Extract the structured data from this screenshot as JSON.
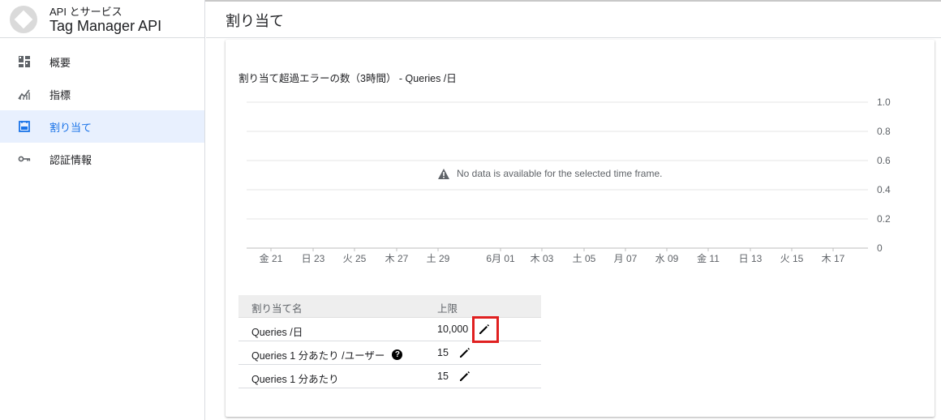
{
  "app": {
    "breadcrumb": "API とサービス",
    "title": "Tag Manager API"
  },
  "sidebar": {
    "items": [
      {
        "label": "概要",
        "icon": "dashboard-icon",
        "active": false
      },
      {
        "label": "指標",
        "icon": "metrics-icon",
        "active": false
      },
      {
        "label": "割り当て",
        "icon": "quota-icon",
        "active": true
      },
      {
        "label": "認証情報",
        "icon": "key-icon",
        "active": false
      }
    ]
  },
  "page": {
    "title": "割り当て"
  },
  "chart": {
    "title": "割り当て超過エラーの数（3時間） - Queries /日",
    "no_data": "No data is available for the selected time frame."
  },
  "chart_data": {
    "type": "line",
    "title": "割り当て超過エラーの数（3時間） - Queries /日",
    "x": [
      "金 21",
      "日 23",
      "火 25",
      "木 27",
      "土 29",
      "6月 01",
      "木 03",
      "土 05",
      "月 07",
      "水 09",
      "金 11",
      "日 13",
      "火 15",
      "木 17"
    ],
    "y_ticks": [
      "1.0",
      "0.8",
      "0.6",
      "0.4",
      "0.2",
      "0"
    ],
    "ylim": [
      0,
      1.0
    ],
    "series": [],
    "grid": true,
    "annotation": "No data is available for the selected time frame."
  },
  "table": {
    "headers": {
      "name": "割り当て名",
      "limit": "上限"
    },
    "rows": [
      {
        "name": "Queries /日",
        "limit": "10,000",
        "help": false
      },
      {
        "name": "Queries 1 分あたり /ユーザー",
        "limit": "15",
        "help": true
      },
      {
        "name": "Queries 1 分あたり",
        "limit": "15",
        "help": false
      }
    ],
    "help_glyph": "?"
  },
  "colors": {
    "accent": "#1a73e8",
    "active_bg": "#e8f0fe",
    "highlight": "#e02020"
  }
}
